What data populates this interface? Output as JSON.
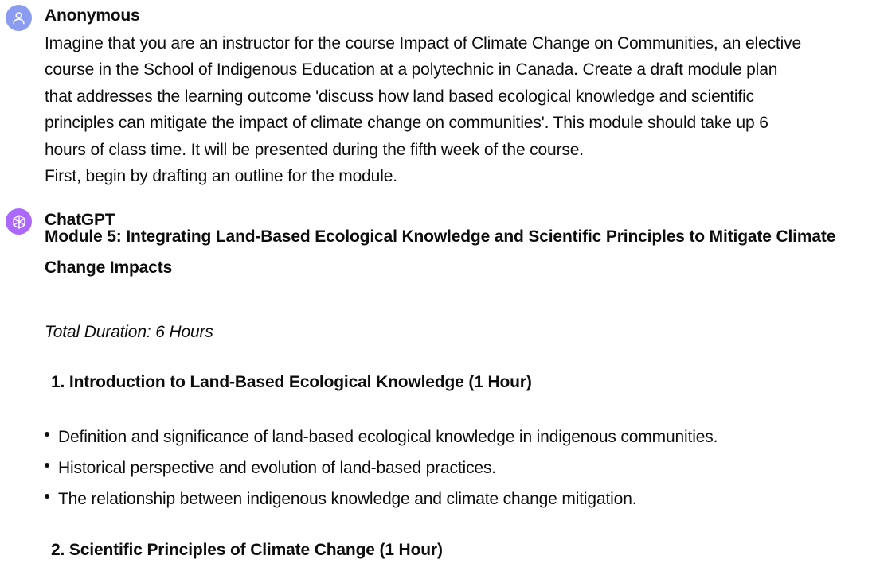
{
  "conversation": {
    "user_message": {
      "author": "Anonymous",
      "avatar_icon": "user-icon",
      "lines": [
        "Imagine that you are an instructor for the course Impact of Climate Change on Communities, an elective",
        "course in the School of Indigenous Education at a polytechnic in Canada. Create a draft module plan",
        "that addresses the learning outcome 'discuss how land based ecological knowledge and scientific",
        "principles can mitigate the impact of climate change on communities'. This module should take up 6",
        "hours of class time. It will be presented during the fifth week of the course.",
        "First, begin by drafting an outline for the module."
      ]
    },
    "assistant_message": {
      "author": "ChatGPT",
      "avatar_icon": "openai-logo-icon",
      "module_title": "Module 5: Integrating Land-Based Ecological Knowledge and Scientific Principles to Mitigate Climate Change Impacts",
      "duration": "Total Duration: 6 Hours",
      "sections": [
        {
          "heading": "1. Introduction to Land-Based Ecological Knowledge (1 Hour)",
          "bullets": [
            "Definition and significance of land-based ecological knowledge in indigenous communities.",
            "Historical perspective and evolution of land-based practices.",
            "The relationship between indigenous knowledge and climate change mitigation."
          ]
        },
        {
          "heading": "2. Scientific Principles of Climate Change (1 Hour)",
          "bullets": []
        }
      ]
    }
  },
  "colors": {
    "user_avatar_bg": "#8b9cf0",
    "assistant_avatar_bg": "#ab68ff",
    "text": "#0d0d0d"
  }
}
